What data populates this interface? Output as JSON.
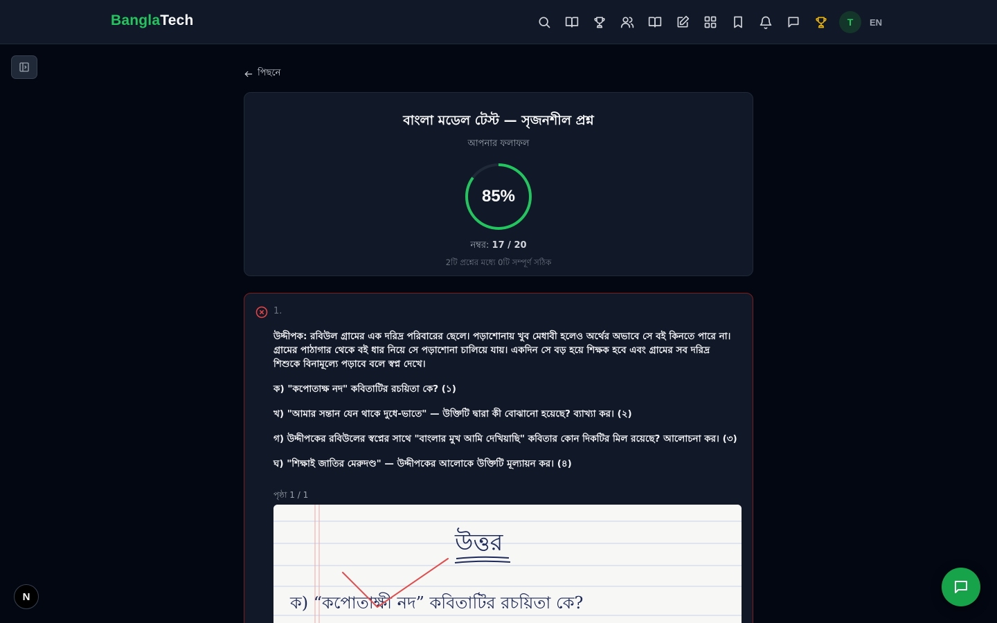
{
  "brand": {
    "part1": "Bangla",
    "part2": "Tech"
  },
  "nav": {
    "icons": [
      "search-icon",
      "book-open-icon",
      "trophy-icon",
      "users-icon",
      "library-icon",
      "edit-icon",
      "grid-icon",
      "bookmark-icon",
      "bell-icon",
      "chat-icon",
      "leaderboard-trophy-icon"
    ],
    "avatar_initial": "T",
    "language": "EN"
  },
  "back_label": "পিছনে",
  "result": {
    "title": "বাংলা মডেল টেস্ট — সৃজনশীল প্রশ্ন",
    "subtitle": "আপনার ফলাফল",
    "percent_text": "85%",
    "percent": 85,
    "score_label": "নম্বর:",
    "score_value": "17 / 20",
    "note": "2টি প্রশ্নের মধ্যে 0টি সম্পূর্ণ সঠিক"
  },
  "question": {
    "number": "1.",
    "stimulus": "উদ্দীপক: রবিউল গ্রামের এক দরিদ্র পরিবারের ছেলে। পড়াশোনায় খুব মেধাবী হলেও অর্থের অভাবে সে বই কিনতে পারে না। গ্রামের পাঠাগার থেকে বই ধার নিয়ে সে পড়াশোনা চালিয়ে যায়। একদিন সে বড় হয়ে শিক্ষক হবে এবং গ্রামের সব দরিদ্র শিশুকে বিনামূল্যে পড়াবে বলে স্বপ্ন দেখে।",
    "parts": [
      "ক) \"কপোতাক্ষ নদ\" কবিতাটির রচয়িতা কে? (১)",
      "খ) \"আমার সন্তান যেন থাকে দুধে-ভাতে\" — উক্তিটি দ্বারা কী বোঝানো হয়েছে? ব্যাখ্যা কর। (২)",
      "গ) উদ্দীপকের রবিউলের স্বপ্নের সাথে \"বাংলার মুখ আমি দেখিয়াছি\" কবিতার কোন দিকটির মিল রয়েছে? আলোচনা কর। (৩)",
      "ঘ) \"শিক্ষাই জাতির মেরুদণ্ড\" — উদ্দীপকের আলোকে উক্তিটি মূল্যায়ন কর। (৪)"
    ],
    "page_label": "পৃষ্ঠা 1 / 1",
    "answer_heading": "উত্তর",
    "answer_line": "ক) “কপোতাক্ষী নদ” কবিতাটির রচয়িতা কে?"
  },
  "colors": {
    "accent": "#22c55e",
    "error": "#ef4444",
    "bg": "#030712",
    "card": "#111827"
  },
  "floating": {
    "chat_icon": "chat-icon",
    "next_badge": "N"
  }
}
